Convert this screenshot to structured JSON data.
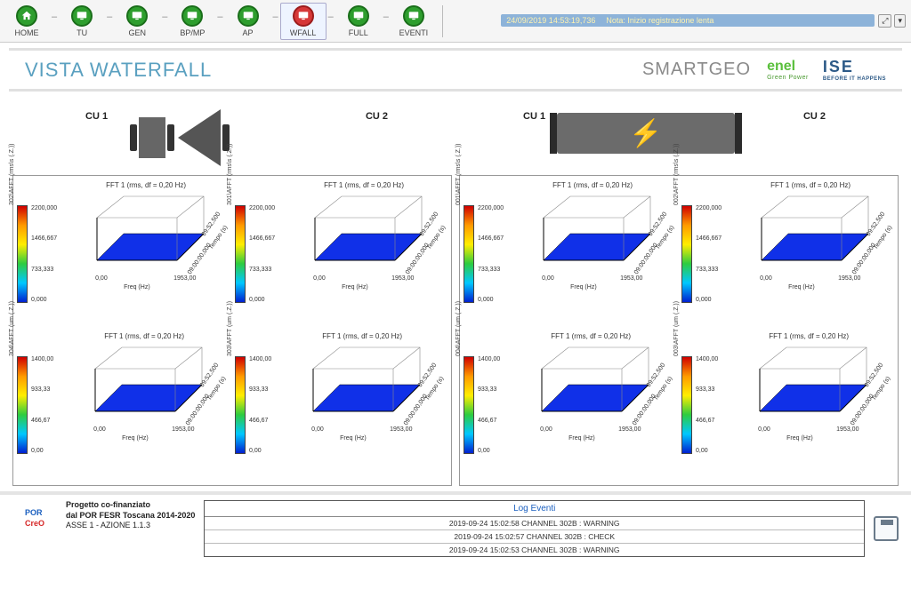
{
  "toolbar": {
    "items": [
      {
        "label": "HOME",
        "icon": "home-icon",
        "color": "green"
      },
      {
        "label": "TU",
        "icon": "monitor-icon",
        "color": "green"
      },
      {
        "label": "GEN",
        "icon": "monitor-icon",
        "color": "green"
      },
      {
        "label": "BP/MP",
        "icon": "monitor-icon",
        "color": "green"
      },
      {
        "label": "AP",
        "icon": "monitor-icon",
        "color": "green"
      },
      {
        "label": "WFALL",
        "icon": "monitor-icon",
        "color": "red",
        "active": true
      },
      {
        "label": "FULL",
        "icon": "monitor-icon",
        "color": "green"
      },
      {
        "label": "EVENTI",
        "icon": "monitor-icon",
        "color": "green"
      }
    ],
    "status_time": "24/09/2019 14:53:19,736",
    "status_note": "Nota: Inizio registrazione lenta"
  },
  "header": {
    "title": "VISTA WATERFALL",
    "brand": "SMARTGEO",
    "logo1": "enel",
    "logo1_sub": "Green Power",
    "logo2": "ISE",
    "logo2_sub": "BEFORE IT HAPPENS"
  },
  "diagrams": {
    "left": {
      "cu1": "CU 1",
      "cu2": "CU 2"
    },
    "right": {
      "cu1": "CU 1",
      "cu2": "CU 2"
    }
  },
  "chart_data": [
    {
      "panel": "left",
      "charts": [
        {
          "title": "FFT 1 (rms, df = 0,20 Hz)",
          "zlabel": "302\\AFFT (rms\\s (.Z.))",
          "zticks": [
            "2200,000",
            "1466,667",
            "733,333",
            "0,000"
          ],
          "xlabel": "Freq (Hz)",
          "xticks": [
            "0,00",
            "1953,00"
          ],
          "ylabel": "Tempo (s)",
          "yticks": [
            "09:00:00,000",
            "09:52,500"
          ]
        },
        {
          "title": "FFT 1 (rms, df = 0,20 Hz)",
          "zlabel": "301\\AFFT (rms\\s (.Z.))",
          "zticks": [
            "2200,000",
            "1466,667",
            "733,333",
            "0,000"
          ],
          "xlabel": "Freq (Hz)",
          "xticks": [
            "0,00",
            "1953,00"
          ],
          "ylabel": "Tempo (s)",
          "yticks": [
            "09:00:00,000",
            "09:52,500"
          ]
        },
        {
          "title": "FFT 1 (rms, df = 0,20 Hz)",
          "zlabel": "304\\AFFT (um (.Z.))",
          "zticks": [
            "1400,00",
            "933,33",
            "466,67",
            "0,00"
          ],
          "xlabel": "Freq (Hz)",
          "xticks": [
            "0,00",
            "1953,00"
          ],
          "ylabel": "Tempo (s)",
          "yticks": [
            "09:00:00,000",
            "09:52,500"
          ]
        },
        {
          "title": "FFT 1 (rms, df = 0,20 Hz)",
          "zlabel": "303\\AFFT (um (.Z.))",
          "zticks": [
            "1400,00",
            "933,33",
            "466,67",
            "0,00"
          ],
          "xlabel": "Freq (Hz)",
          "xticks": [
            "0,00",
            "1953,00"
          ],
          "ylabel": "Tempo (s)",
          "yticks": [
            "09:00:00,000",
            "09:52,500"
          ]
        }
      ]
    },
    {
      "panel": "right",
      "charts": [
        {
          "title": "FFT 1 (rms, df = 0,20 Hz)",
          "zlabel": "001\\AFFT (rms\\s (.Z.))",
          "zticks": [
            "2200,000",
            "1466,667",
            "733,333",
            "0,000"
          ],
          "xlabel": "Freq (Hz)",
          "xticks": [
            "0,00",
            "1953,00"
          ],
          "ylabel": "Tempo (s)",
          "yticks": [
            "09:00:00,000",
            "09:52,500"
          ]
        },
        {
          "title": "FFT 1 (rms, df = 0,20 Hz)",
          "zlabel": "002\\AFFT (rms\\s (.Z.))",
          "zticks": [
            "2200,000",
            "1466,667",
            "733,333",
            "0,000"
          ],
          "xlabel": "Freq (Hz)",
          "xticks": [
            "0,00",
            "1953,00"
          ],
          "ylabel": "Tempo (s)",
          "yticks": [
            "09:00:00,000",
            "09:52,500"
          ]
        },
        {
          "title": "FFT 1 (rms, df = 0,20 Hz)",
          "zlabel": "004\\AFFT (um (.Z.))",
          "zticks": [
            "1400,00",
            "933,33",
            "466,67",
            "0,00"
          ],
          "xlabel": "Freq (Hz)",
          "xticks": [
            "0,00",
            "1953,00"
          ],
          "ylabel": "Tempo (s)",
          "yticks": [
            "09:00:00,000",
            "09:52,500"
          ]
        },
        {
          "title": "FFT 1 (rms, df = 0,20 Hz)",
          "zlabel": "003\\AFFT (um (.Z.))",
          "zticks": [
            "1400,00",
            "933,33",
            "466,67",
            "0,00"
          ],
          "xlabel": "Freq (Hz)",
          "xticks": [
            "0,00",
            "1953,00"
          ],
          "ylabel": "Tempo (s)",
          "yticks": [
            "09:00:00,000",
            "09:52,500"
          ]
        }
      ]
    }
  ],
  "footer": {
    "por_logo_top": "POR",
    "por_logo_bottom": "CreO",
    "project_line1": "Progetto co-finanziato",
    "project_line2": "dal POR FESR Toscana 2014-2020",
    "project_line3": "ASSE 1 - AZIONE 1.1.3",
    "log_title": "Log Eventi",
    "log_rows": [
      "2019-09-24 15:02:58 CHANNEL 302B : WARNING",
      "2019-09-24 15:02:57 CHANNEL 302B : CHECK",
      "2019-09-24 15:02:53 CHANNEL 302B : WARNING"
    ]
  }
}
